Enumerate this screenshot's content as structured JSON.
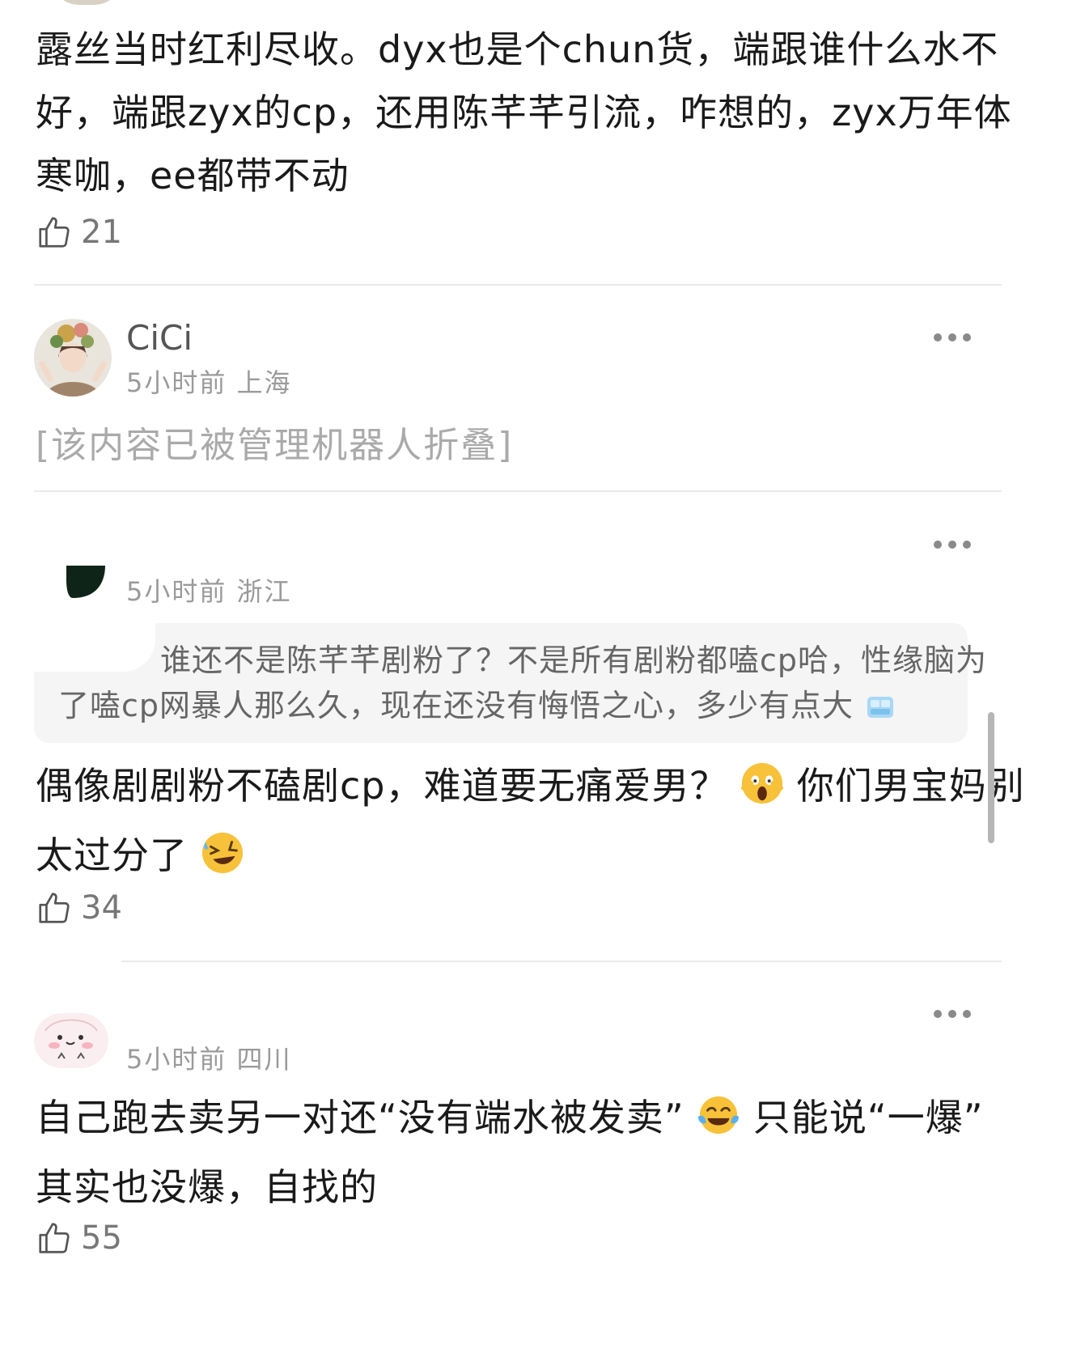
{
  "comment1": {
    "text_lines": [
      "露丝当时红利尽收。dyx也是个chun货，端跟谁什么水不",
      "好，端跟zyx的cp，还用陈芊芊引流，咋想的，zyx万年体",
      "寒咖，ee都带不动"
    ],
    "likes": "21"
  },
  "comment2": {
    "username": "CiCi",
    "time": "5小时前",
    "location": "上海",
    "folded_text": "[该内容已被管理机器人折叠]"
  },
  "comment3": {
    "time": "5小时前",
    "location": "浙江",
    "quote_line1": "谁还不是陈芊芊剧粉了？不是所有剧粉都嗑cp哈，性缘脑为",
    "quote_line2": "了嗑cp网暴人那么久，现在还没有悔悟之心，多少有点大",
    "text_line1": "偶像剧剧粉不磕剧cp，难道要无痛爱男？",
    "text_line1b": "你们男宝妈别",
    "text_line2": "太过分了",
    "likes": "34"
  },
  "comment4": {
    "time": "5小时前",
    "location": "四川",
    "text_line1a": "自己跑去卖另一对还“没有端水被发卖”",
    "text_line1b": "只能说“一爆”",
    "text_line2": "其实也没爆，自找的",
    "likes": "55"
  },
  "icons": {
    "like": "thumbs-up-icon",
    "more": "more-dots-icon",
    "ice": "ice-cube-emoji",
    "scream": "screaming-face-emoji",
    "rofl": "rolling-laughing-emoji",
    "joy": "tears-of-joy-emoji"
  }
}
